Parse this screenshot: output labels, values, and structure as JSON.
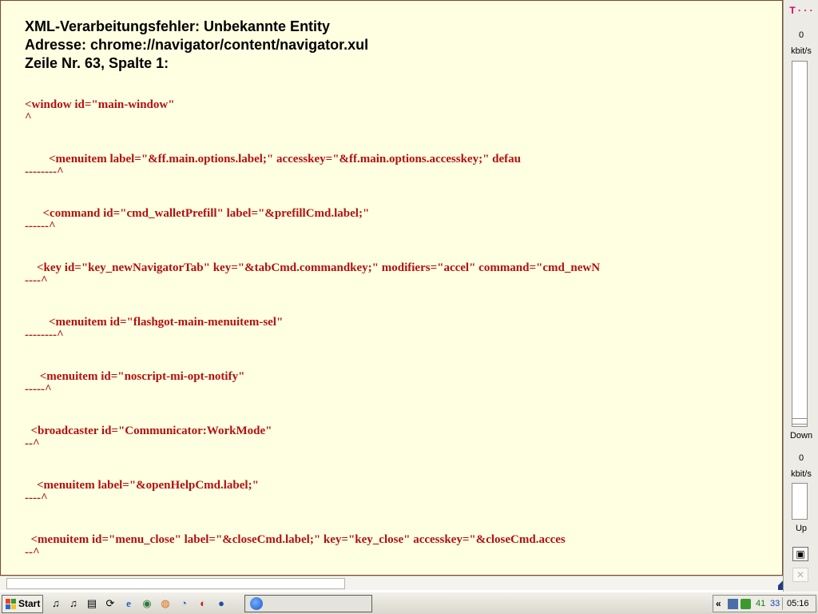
{
  "error": {
    "title": "XML-Verarbeitungsfehler: Unbekannte Entity",
    "address": "Adresse: chrome://navigator/content/navigator.xul",
    "position": "Zeile Nr. 63, Spalte 1:"
  },
  "errors": [
    {
      "source": "<window id=\"main-window\"",
      "marker": "^"
    },
    {
      "source": "        <menuitem label=\"&ff.main.options.label;\" accesskey=\"&ff.main.options.accesskey;\" defau",
      "marker": "--------^"
    },
    {
      "source": "      <command id=\"cmd_walletPrefill\" label=\"&prefillCmd.label;\"",
      "marker": "------^"
    },
    {
      "source": "    <key id=\"key_newNavigatorTab\" key=\"&tabCmd.commandkey;\" modifiers=\"accel\" command=\"cmd_newN",
      "marker": "----^"
    },
    {
      "source": "        <menuitem id=\"flashgot-main-menuitem-sel\"",
      "marker": "--------^"
    },
    {
      "source": "     <menuitem id=\"noscript-mi-opt-notify\"",
      "marker": "-----^"
    },
    {
      "source": "  <broadcaster id=\"Communicator:WorkMode\"",
      "marker": "--^"
    },
    {
      "source": "    <menuitem label=\"&openHelpCmd.label;\"",
      "marker": "----^"
    },
    {
      "source": "  <menuitem id=\"menu_close\" label=\"&closeCmd.label;\" key=\"key_close\" accesskey=\"&closeCmd.acces",
      "marker": "--^"
    }
  ],
  "bandwidth": {
    "logo": "T · · ·",
    "down_value": "0",
    "down_unit": "kbit/s",
    "down_label": "Down",
    "up_value": "0",
    "up_unit": "kbit/s",
    "up_label": "Up",
    "window_button_icon": "window-icon",
    "close_button_icon": "close-icon"
  },
  "taskbar": {
    "start_label": "Start",
    "quick_launch": [
      {
        "icon": "music-note-icon",
        "glyph": "♫"
      },
      {
        "icon": "music-note-icon",
        "glyph": "♫"
      },
      {
        "icon": "document-icon",
        "glyph": "▤"
      },
      {
        "icon": "refresh-icon",
        "glyph": "⟳"
      },
      {
        "icon": "internet-explorer-icon",
        "glyph": "e"
      },
      {
        "icon": "media-player-icon",
        "glyph": "◉"
      },
      {
        "icon": "firefox-icon",
        "glyph": "◍"
      },
      {
        "icon": "browser-icon",
        "glyph": "◔"
      },
      {
        "icon": "acrobat-icon",
        "glyph": "◐"
      },
      {
        "icon": "globe-icon",
        "glyph": "●"
      }
    ],
    "tray_chevron": "«",
    "tray_num_green": "41",
    "tray_num_blue": "33",
    "clock": "05:16"
  }
}
